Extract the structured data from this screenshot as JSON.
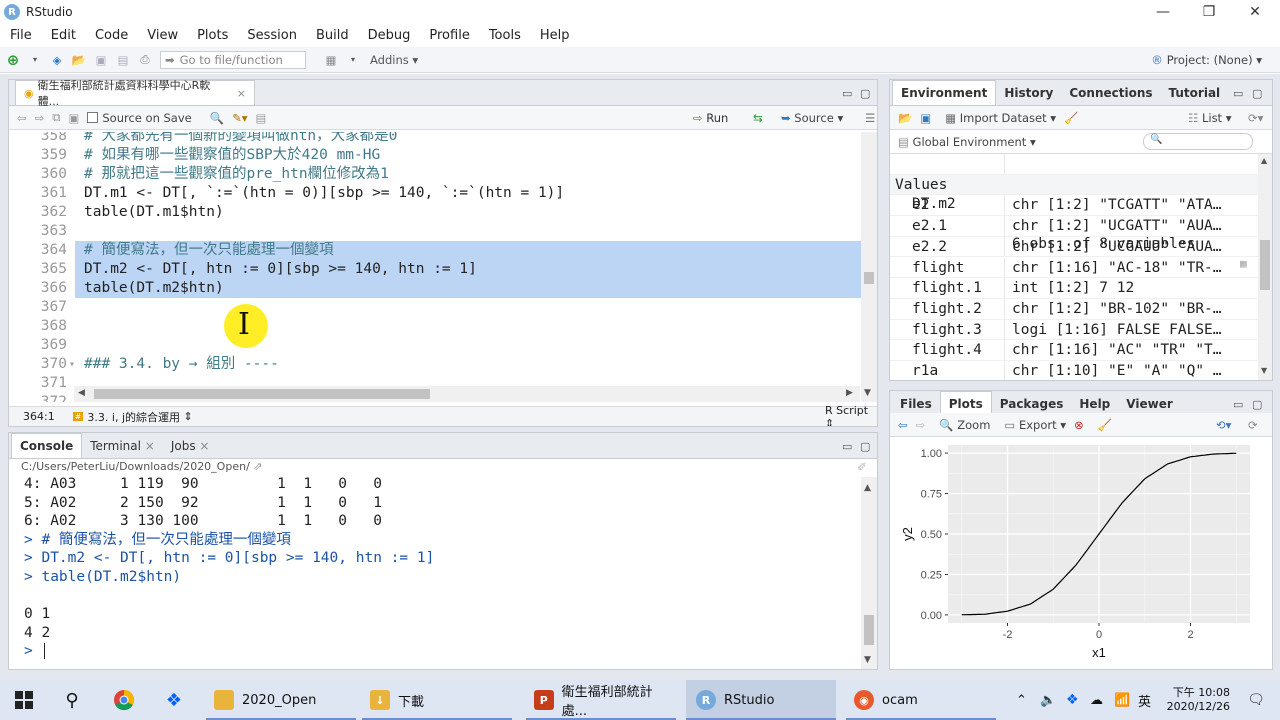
{
  "window": {
    "title": "RStudio",
    "app_icon": "R"
  },
  "menu": [
    "File",
    "Edit",
    "Code",
    "View",
    "Plots",
    "Session",
    "Build",
    "Debug",
    "Profile",
    "Tools",
    "Help"
  ],
  "toolbar": {
    "goto_placeholder": "Go to file/function",
    "addins": "Addins",
    "project": "Project: (None)"
  },
  "editor": {
    "tab_title": "衛生福利部統計處資料科學中心R軟體...",
    "source_on_save": "Source on Save",
    "run": "Run",
    "source": "Source",
    "lines": [
      {
        "n": "358",
        "text": "# 大家都先有一個新的變項叫做htn，大家都是0",
        "kind": "comment"
      },
      {
        "n": "359",
        "text": "# 如果有哪一些觀察值的SBP大於420 mm-HG",
        "kind": "comment"
      },
      {
        "n": "360",
        "text": "# 那就把這一些觀察值的pre_htn欄位修改為1",
        "kind": "comment"
      },
      {
        "n": "361",
        "text": "DT.m1 <- DT[, `:=`(htn = 0)][sbp >= 140, `:=`(htn = 1)]",
        "kind": "code"
      },
      {
        "n": "362",
        "text": "table(DT.m1$htn)",
        "kind": "code"
      },
      {
        "n": "363",
        "text": "",
        "kind": "code"
      },
      {
        "n": "364",
        "text": "# 簡便寫法，但一次只能處理一個變項",
        "kind": "comment",
        "hl": true
      },
      {
        "n": "365",
        "text": "DT.m2 <- DT[, htn := 0][sbp >= 140, htn := 1]",
        "kind": "code",
        "hl": true
      },
      {
        "n": "366",
        "text": "table(DT.m2$htn)",
        "kind": "code",
        "hl": true
      },
      {
        "n": "367",
        "text": "",
        "kind": "code"
      },
      {
        "n": "368",
        "text": "",
        "kind": "code"
      },
      {
        "n": "369",
        "text": "",
        "kind": "code"
      },
      {
        "n": "370",
        "text": "### 3.4. by → 組別 ----",
        "kind": "comment"
      },
      {
        "n": "371",
        "text": "",
        "kind": "code"
      },
      {
        "n": "372",
        "text": "",
        "kind": "code"
      }
    ],
    "status_pos": "364:1",
    "status_section": "3.3. i, j的綜合運用",
    "status_type": "R Script"
  },
  "console": {
    "tabs": [
      "Console",
      "Terminal",
      "Jobs"
    ],
    "path": "C:/Users/PeterLiu/Downloads/2020_Open/",
    "lines": [
      {
        "text": "4: A03     1 119  90         1  1   0   0",
        "prompt": false
      },
      {
        "text": "5: A02     2 150  92         1  1   0   1",
        "prompt": false
      },
      {
        "text": "6: A02     3 130 100         1  1   0   0",
        "prompt": false
      },
      {
        "text": "> # 簡便寫法，但一次只能處理一個變項",
        "prompt": true
      },
      {
        "text": "> DT.m2 <- DT[, htn := 0][sbp >= 140, htn := 1]",
        "prompt": true
      },
      {
        "text": "> table(DT.m2$htn)",
        "prompt": true
      },
      {
        "text": "",
        "prompt": false
      },
      {
        "text": "0 1",
        "prompt": false
      },
      {
        "text": "4 2",
        "prompt": false
      },
      {
        "text": "> ",
        "prompt": true
      }
    ]
  },
  "environment": {
    "tabs": [
      "Environment",
      "History",
      "Connections",
      "Tutorial"
    ],
    "import_dataset": "Import Dataset",
    "list_label": "List",
    "global_env": "Global Environment",
    "search_placeholder": "",
    "data_row": {
      "name": "DT.m2",
      "value": "6 obs. of 8 variables"
    },
    "values_header": "Values",
    "rows": [
      {
        "name": "e2",
        "value": "chr [1:2] \"TCGATT\" \"ATA…"
      },
      {
        "name": "e2.1",
        "value": "chr [1:2] \"UCGATT\" \"AUA…"
      },
      {
        "name": "e2.2",
        "value": "chr [1:2] \"UCGAUU\" \"AUA…"
      },
      {
        "name": "flight",
        "value": "chr [1:16] \"AC-18\" \"TR-…"
      },
      {
        "name": "flight.1",
        "value": "int [1:2] 7 12"
      },
      {
        "name": "flight.2",
        "value": "chr [1:2] \"BR-102\" \"BR-…"
      },
      {
        "name": "flight.3",
        "value": "logi [1:16] FALSE FALSE…"
      },
      {
        "name": "flight.4",
        "value": "chr [1:16] \"AC\" \"TR\" \"T…"
      },
      {
        "name": "r1a",
        "value": "chr [1:10] \"E\" \"A\" \"Q\" …"
      }
    ]
  },
  "files": {
    "tabs": [
      "Files",
      "Plots",
      "Packages",
      "Help",
      "Viewer"
    ],
    "zoom": "Zoom",
    "export": "Export"
  },
  "chart_data": {
    "type": "line",
    "xlabel": "x1",
    "ylabel": "y2",
    "xlim": [
      -3.3,
      3.3
    ],
    "ylim": [
      -0.05,
      1.05
    ],
    "x_ticks": [
      -2,
      0,
      2
    ],
    "x_tick_labels": [
      "-2",
      "0",
      "2"
    ],
    "y_ticks": [
      0,
      0.25,
      0.5,
      0.75,
      1
    ],
    "y_tick_labels": [
      "0.00",
      "0.25",
      "0.50",
      "0.75",
      "1.00"
    ],
    "grid": true,
    "series": [
      {
        "x": [
          -3.0,
          -2.5,
          -2.0,
          -1.5,
          -1.0,
          -0.5,
          0.0,
          0.5,
          1.0,
          1.5,
          2.0,
          2.5,
          3.0
        ],
        "y": [
          0.001,
          0.004,
          0.023,
          0.067,
          0.159,
          0.309,
          0.5,
          0.691,
          0.841,
          0.933,
          0.977,
          0.994,
          0.999
        ]
      }
    ],
    "background": "#ebebeb",
    "line_color": "#000000"
  },
  "taskbar": {
    "items": [
      {
        "label": "2020_Open",
        "icon": "folder"
      },
      {
        "label": "下載",
        "icon": "folder-download"
      },
      {
        "label": "衛生福利部統計處...",
        "icon": "powerpoint"
      },
      {
        "label": "RStudio",
        "icon": "rstudio",
        "active": true
      },
      {
        "label": "ocam",
        "icon": "ocam"
      }
    ],
    "ime": "英",
    "time": "下午 10:08",
    "date": "2020/12/26"
  }
}
